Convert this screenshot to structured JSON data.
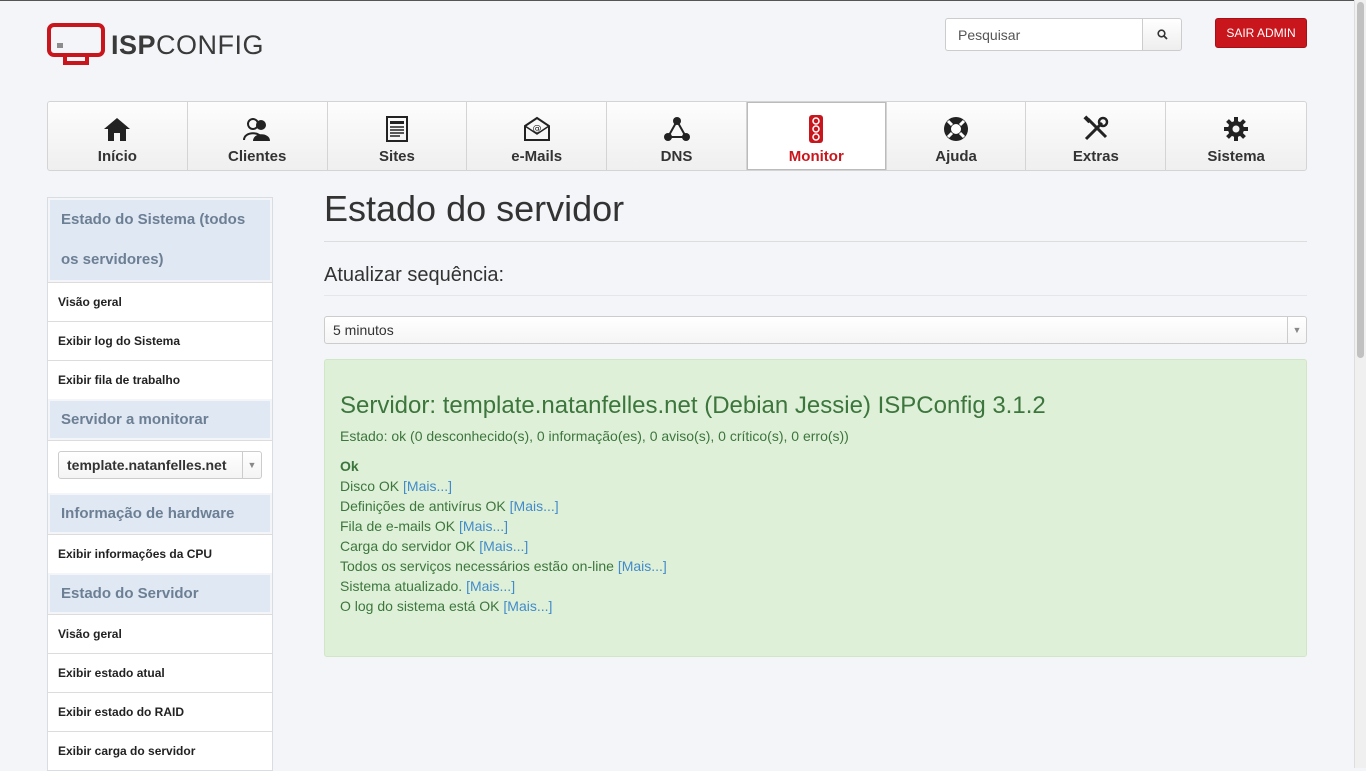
{
  "header": {
    "logo_text_bold": "ISP",
    "logo_text_regular": "CONFIG",
    "search_placeholder": "Pesquisar",
    "logout_label": "SAIR ADMIN"
  },
  "nav": {
    "items": [
      {
        "label": "Início",
        "icon": "home-icon"
      },
      {
        "label": "Clientes",
        "icon": "users-icon"
      },
      {
        "label": "Sites",
        "icon": "document-icon"
      },
      {
        "label": "e-Mails",
        "icon": "mail-icon"
      },
      {
        "label": "DNS",
        "icon": "network-icon"
      },
      {
        "label": "Monitor",
        "icon": "traffic-light-icon",
        "active": true
      },
      {
        "label": "Ajuda",
        "icon": "lifebuoy-icon"
      },
      {
        "label": "Extras",
        "icon": "tools-icon"
      },
      {
        "label": "Sistema",
        "icon": "gear-icon"
      }
    ],
    "active_color": "#c9161d"
  },
  "sidebar": {
    "sections": [
      {
        "title": "Estado do Sistema (todos os servidores)",
        "links": [
          "Visão geral",
          "Exibir log do Sistema",
          "Exibir fila de trabalho"
        ]
      },
      {
        "title": "Servidor a monitorar",
        "select_value": "template.natanfelles.net"
      },
      {
        "title": "Informação de hardware",
        "links": [
          "Exibir informações da CPU"
        ]
      },
      {
        "title": "Estado do Servidor",
        "links": [
          "Visão geral",
          "Exibir estado atual",
          "Exibir estado do RAID",
          "Exibir carga do servidor"
        ]
      }
    ]
  },
  "main": {
    "title": "Estado do servidor",
    "refresh_label": "Atualizar sequência:",
    "refresh_value": "5 minutos",
    "server_line": "Servidor: template.natanfelles.net (Debian Jessie) ISPConfig 3.1.2",
    "state_line": "Estado: ok (0 desconhecido(s), 0 informação(es), 0 aviso(s), 0 crítico(s), 0 erro(s))",
    "ok_label": "Ok",
    "more_label": "[Mais...]",
    "checks": [
      "Disco OK",
      "Definições de antivírus OK",
      "Fila de e-mails OK",
      "Carga do servidor OK",
      "Todos os serviços necessários estão on-line",
      "Sistema atualizado.",
      "O log do sistema está OK"
    ],
    "status_color": "#3c763d",
    "status_bg": "#dff0d8"
  }
}
